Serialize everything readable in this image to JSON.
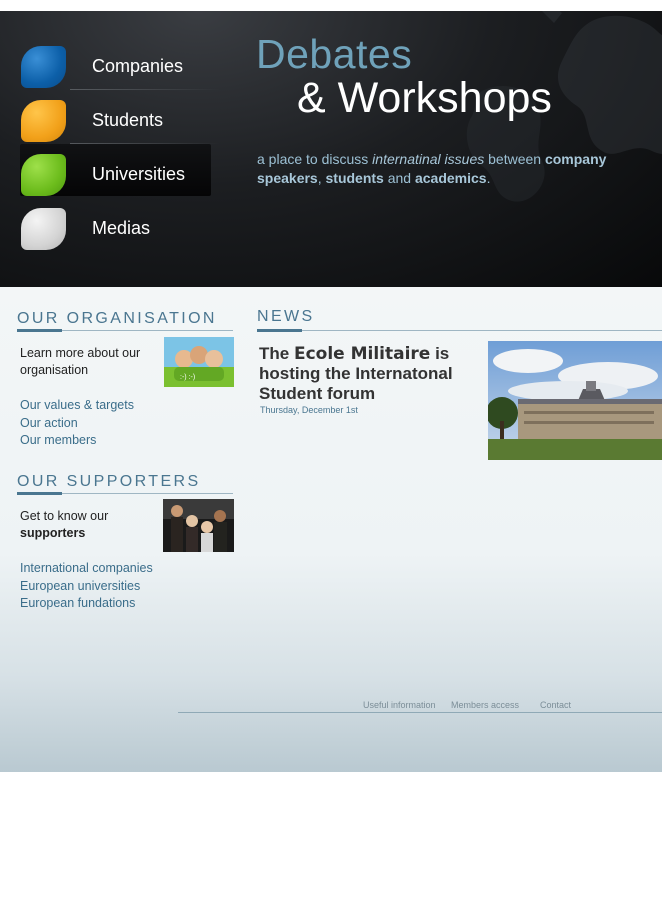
{
  "colors": {
    "accent": "#4a7690",
    "title_blue": "#6fa2ba",
    "header_bg": "#0b0c0d"
  },
  "nav": {
    "items": [
      {
        "label": "Companies",
        "leaf": "blue"
      },
      {
        "label": "Students",
        "leaf": "orange"
      },
      {
        "label": "Universities",
        "leaf": "green",
        "active": true
      },
      {
        "label": "Medias",
        "leaf": "grey"
      }
    ]
  },
  "hero": {
    "title_line1": "Debates",
    "title_line2": "& Workshops",
    "tagline": {
      "p1": "a place to discuss ",
      "em1": "internatinal issues",
      "p2": " between ",
      "b1": "company speakers",
      "p3": ", ",
      "b2": "students",
      "p4": " and ",
      "b3": "academics",
      "p5": "."
    }
  },
  "organisation": {
    "title": "OUR ORGANISATION",
    "lead": "Learn more about our organisation",
    "links": [
      "Our values & targets",
      "Our action",
      "Our members"
    ]
  },
  "supporters": {
    "title": "OUR SUPPORTERS",
    "lead_plain": "Get to know our",
    "lead_bold": "supporters",
    "links": [
      "International companies",
      "European universities",
      "European fundations"
    ]
  },
  "news": {
    "title": "NEWS",
    "headline_p1": "The ",
    "headline_bold": "Ecole Militaire",
    "headline_p2": " is hosting the Internatonal Student forum",
    "date": "Thursday, December 1st"
  },
  "footer": {
    "links": [
      "Useful information",
      "Members access",
      "Contact"
    ]
  }
}
